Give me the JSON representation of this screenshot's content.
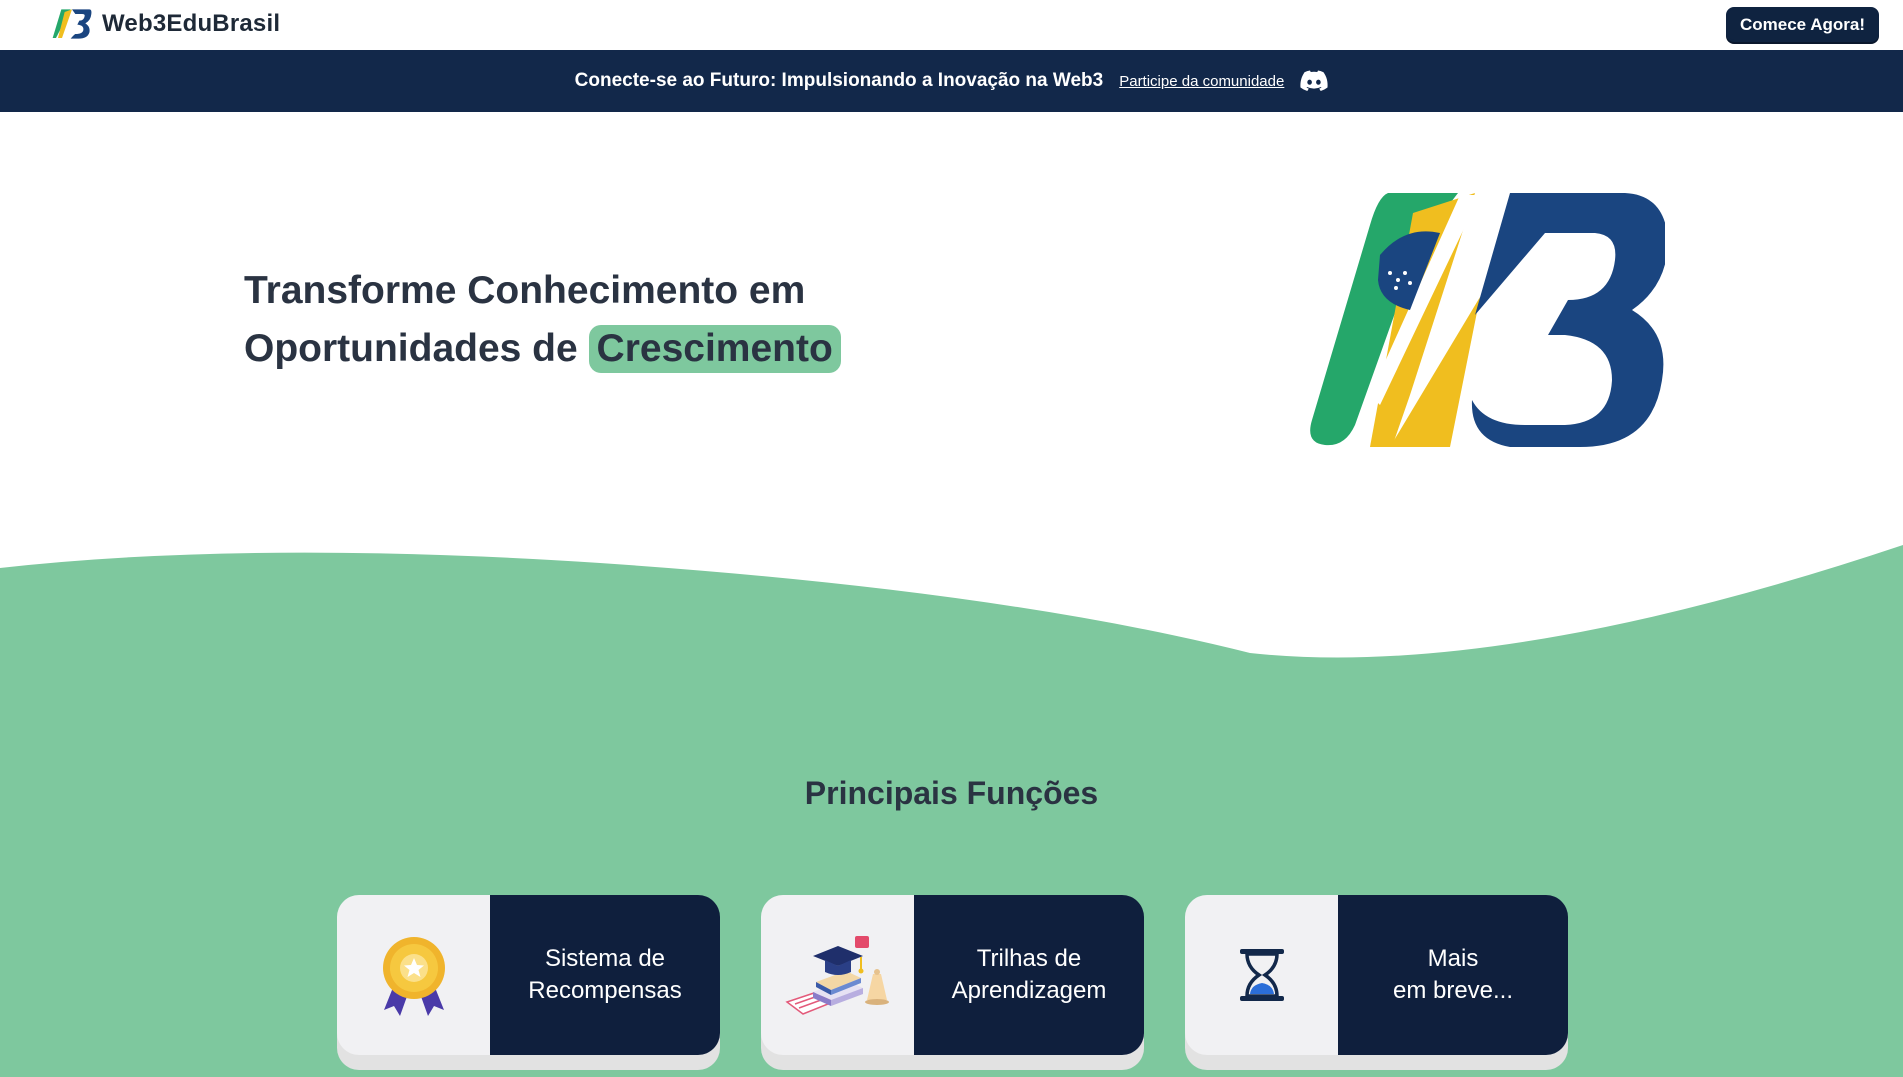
{
  "header": {
    "brand_name": "Web3EduBrasil",
    "cta_label": "Comece Agora!"
  },
  "announcement": {
    "text": "Conecte-se ao Futuro: Impulsionando a Inovação na Web3",
    "link_label": "Participe da comunidade",
    "icon": "discord-icon"
  },
  "hero": {
    "title_line1": "Transforme Conhecimento em",
    "title_line2_prefix": "Oportunidades de",
    "title_highlight": "Crescimento"
  },
  "features": {
    "title": "Principais Funções",
    "cards": [
      {
        "icon": "medal-icon",
        "line1": "Sistema de",
        "line2": "Recompensas"
      },
      {
        "icon": "graduation-books-icon",
        "line1": "Trilhas de",
        "line2": "Aprendizagem"
      },
      {
        "icon": "hourglass-icon",
        "line1": "Mais",
        "line2": "em breve..."
      }
    ]
  },
  "colors": {
    "navy": "#12284a",
    "card_navy": "#0f1f3d",
    "green": "#7ec89e",
    "logo_blue": "#1a4580",
    "logo_yellow": "#f0be1f",
    "logo_green": "#25a76a"
  }
}
